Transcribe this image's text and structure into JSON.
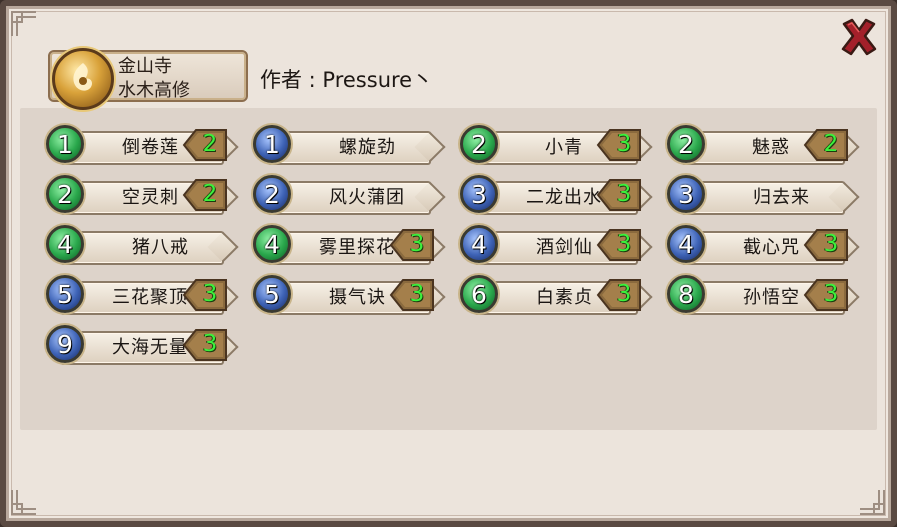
{
  "header": {
    "deck_name": "金山寺",
    "deck_subtitle": "水木高修",
    "author": "作者 : Pressure丶"
  },
  "cards": [
    {
      "cost": "1",
      "name": "倒卷莲",
      "count": "2",
      "color": "green"
    },
    {
      "cost": "1",
      "name": "螺旋劲",
      "count": "",
      "color": "blue"
    },
    {
      "cost": "2",
      "name": "小青",
      "count": "3",
      "color": "green"
    },
    {
      "cost": "2",
      "name": "魅惑",
      "count": "2",
      "color": "green"
    },
    {
      "cost": "2",
      "name": "空灵刺",
      "count": "2",
      "color": "green"
    },
    {
      "cost": "2",
      "name": "风火蒲团",
      "count": "",
      "color": "blue"
    },
    {
      "cost": "3",
      "name": "二龙出水",
      "count": "3",
      "color": "blue"
    },
    {
      "cost": "3",
      "name": "归去来",
      "count": "",
      "color": "blue"
    },
    {
      "cost": "4",
      "name": "猪八戒",
      "count": "",
      "color": "green"
    },
    {
      "cost": "4",
      "name": "雾里探花",
      "count": "3",
      "color": "green"
    },
    {
      "cost": "4",
      "name": "酒剑仙",
      "count": "3",
      "color": "blue"
    },
    {
      "cost": "4",
      "name": "截心咒",
      "count": "3",
      "color": "blue"
    },
    {
      "cost": "5",
      "name": "三花聚顶",
      "count": "3",
      "color": "blue"
    },
    {
      "cost": "5",
      "name": "摄气诀",
      "count": "3",
      "color": "blue"
    },
    {
      "cost": "6",
      "name": "白素贞",
      "count": "3",
      "color": "green"
    },
    {
      "cost": "8",
      "name": "孙悟空",
      "count": "3",
      "color": "green"
    },
    {
      "cost": "9",
      "name": "大海无量",
      "count": "3",
      "color": "blue"
    }
  ]
}
